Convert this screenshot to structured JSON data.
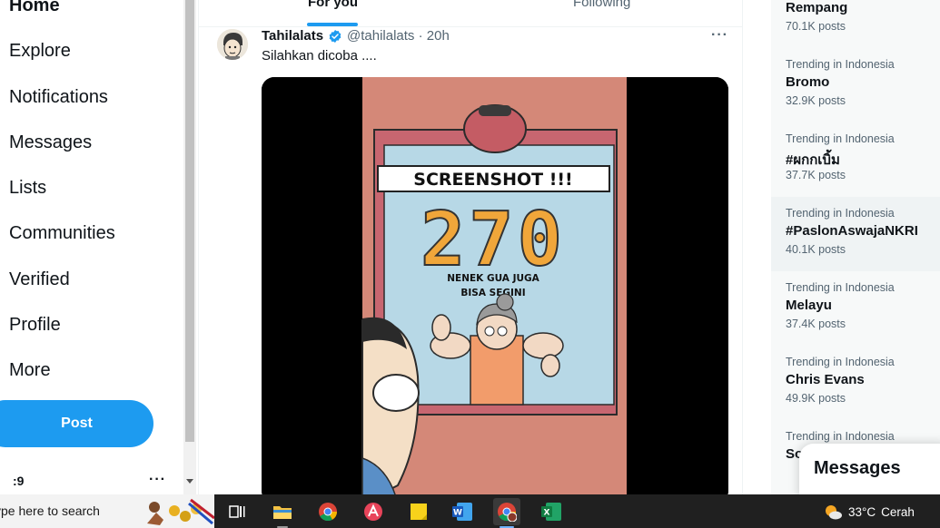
{
  "nav": {
    "items": [
      {
        "label": "Home"
      },
      {
        "label": "Explore"
      },
      {
        "label": "Notifications"
      },
      {
        "label": "Messages"
      },
      {
        "label": "Lists"
      },
      {
        "label": "Communities"
      },
      {
        "label": "Verified"
      },
      {
        "label": "Profile"
      },
      {
        "label": "More"
      }
    ],
    "post_label": "Post",
    "account_name": ":9",
    "more_dots": "···"
  },
  "timeline": {
    "tabs": [
      {
        "label": "For you",
        "active": true
      },
      {
        "label": "Following",
        "active": false
      }
    ],
    "tweet": {
      "author": "Tahilalats",
      "handle": "@tahilalats · 20h",
      "text": "Silahkan dicoba ....",
      "more": "···",
      "media": {
        "banner": "SCREENSHOT !!!",
        "number": "270",
        "caption_line1": "NENEK GUA JUGA",
        "caption_line2": "BISA SEGINI"
      }
    }
  },
  "trends": [
    {
      "context": "",
      "name": "Rempang",
      "posts": "70.1K posts"
    },
    {
      "context": "Trending in Indonesia",
      "name": "Bromo",
      "posts": "32.9K posts"
    },
    {
      "context": "Trending in Indonesia",
      "name": "#ผกกเบิ้ม",
      "posts": "37.7K posts"
    },
    {
      "context": "Trending in Indonesia",
      "name": "#PaslonAswajaNKRI",
      "posts": "40.1K posts"
    },
    {
      "context": "Trending in Indonesia",
      "name": "Melayu",
      "posts": "37.4K posts"
    },
    {
      "context": "Trending in Indonesia",
      "name": "Chris Evans",
      "posts": "49.9K posts"
    },
    {
      "context": "Trending in Indonesia",
      "name": "So",
      "posts": ""
    }
  ],
  "messages_drawer": {
    "label": "Messages"
  },
  "taskbar": {
    "search_placeholder": "ype here to search",
    "apps": [
      "task-view",
      "file-explorer",
      "chrome",
      "todo-app",
      "sticky-notes",
      "word",
      "chrome-profile",
      "excel"
    ],
    "weather": {
      "temp": "33°C",
      "condition": "Cerah"
    }
  },
  "colors": {
    "accent": "#1d9bf0",
    "taskbar": "#202020",
    "right_column_bg": "#f7f9f9"
  }
}
